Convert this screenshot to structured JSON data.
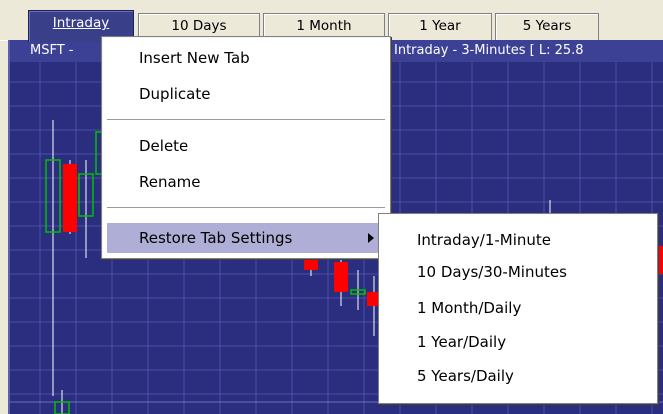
{
  "tabs": [
    {
      "label": "Intraday",
      "active": true
    },
    {
      "label": "10 Days",
      "active": false
    },
    {
      "label": "1 Month",
      "active": false
    },
    {
      "label": "1 Year",
      "active": false
    },
    {
      "label": "5 Years",
      "active": false
    }
  ],
  "chart": {
    "header_left": "MSFT -",
    "header_right": "Intraday - 3-Minutes [ L: 25.8",
    "colors": {
      "background": "#2b2e7e",
      "grid": "#4b50a8",
      "up": "#00c000",
      "down": "#ff0000",
      "wick": "#ffffff"
    }
  },
  "context_menu": {
    "items": [
      "Insert New Tab",
      "Duplicate",
      "Delete",
      "Rename"
    ],
    "restore_label": "Restore Tab Settings"
  },
  "submenu": {
    "items": [
      "Intraday/1-Minute",
      "10 Days/30-Minutes",
      "1 Month/Daily",
      "1 Year/Daily",
      "5 Years/Daily"
    ]
  }
}
